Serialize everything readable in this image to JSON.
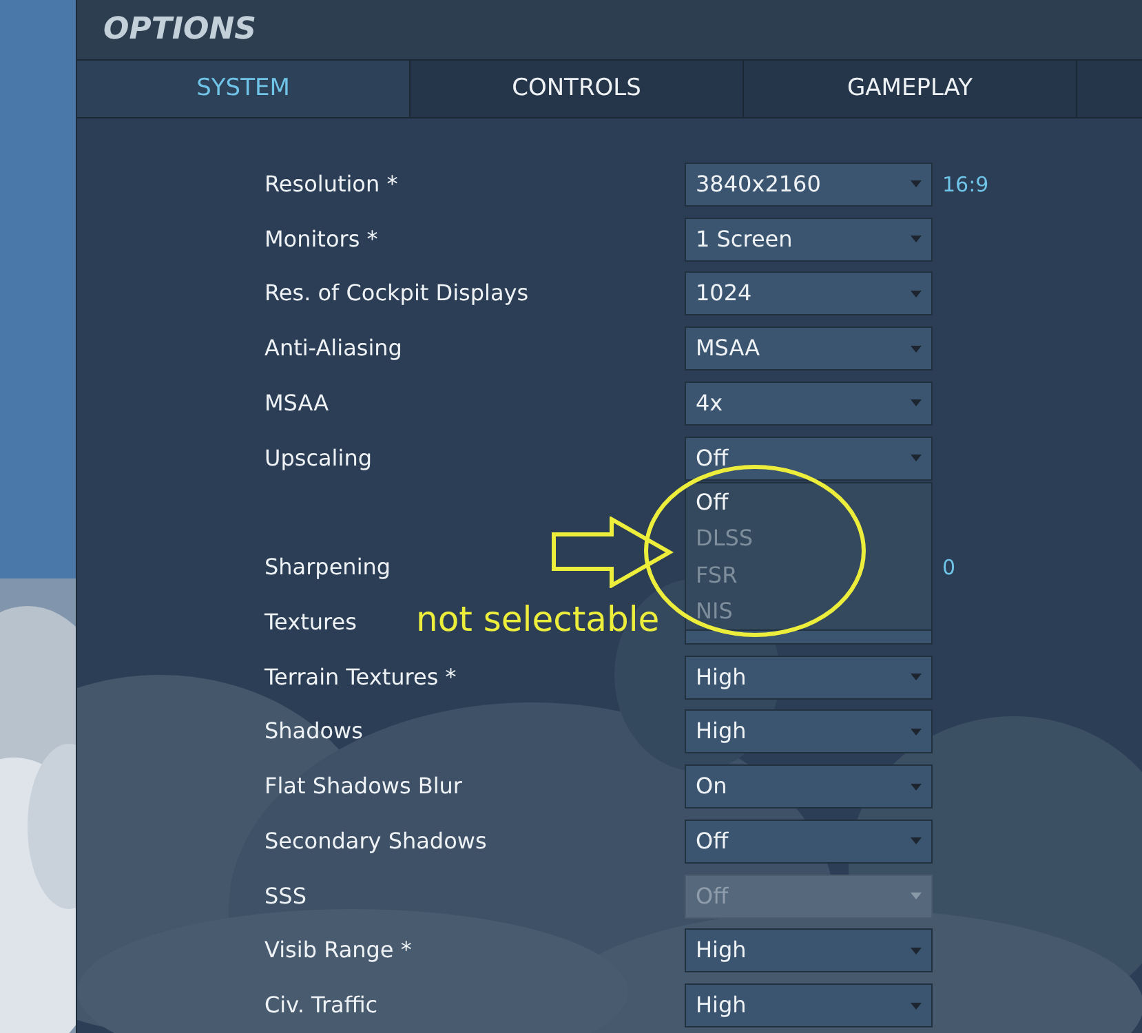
{
  "window": {
    "title": "OPTIONS"
  },
  "tabs": [
    {
      "label": "SYSTEM",
      "selected": true
    },
    {
      "label": "CONTROLS",
      "selected": false
    },
    {
      "label": "GAMEPLAY",
      "selected": false
    }
  ],
  "settings": [
    {
      "kind": "select",
      "label": "Resolution *",
      "value": "3840x2160",
      "disabled": false,
      "note": "16:9"
    },
    {
      "kind": "select",
      "label": "Monitors *",
      "value": "1 Screen",
      "disabled": false
    },
    {
      "kind": "select",
      "label": "Res. of Cockpit Displays",
      "value": "1024",
      "disabled": false
    },
    {
      "kind": "select",
      "label": "Anti-Aliasing",
      "value": "MSAA",
      "disabled": false
    },
    {
      "kind": "select",
      "label": "MSAA",
      "value": "4x",
      "disabled": false
    },
    {
      "kind": "select",
      "label": "Upscaling",
      "value": "Off",
      "disabled": false,
      "expanded": true,
      "options": [
        {
          "label": "Off",
          "disabled": false
        },
        {
          "label": "DLSS",
          "disabled": true
        },
        {
          "label": "FSR",
          "disabled": true
        },
        {
          "label": "NIS",
          "disabled": true
        }
      ]
    },
    {
      "kind": "reading",
      "label": "Sharpening",
      "reading": "0"
    },
    {
      "kind": "select",
      "label": "Textures",
      "disabled": false
    },
    {
      "kind": "select",
      "label": "Terrain Textures *",
      "value": "High",
      "disabled": false
    },
    {
      "kind": "select",
      "label": "Shadows",
      "value": "High",
      "disabled": false
    },
    {
      "kind": "select",
      "label": "Flat Shadows Blur",
      "value": "On",
      "disabled": false
    },
    {
      "kind": "select",
      "label": "Secondary Shadows",
      "value": "Off",
      "disabled": false
    },
    {
      "kind": "select",
      "label": "SSS",
      "value": "Off",
      "disabled": true
    },
    {
      "kind": "select",
      "label": "Visib Range *",
      "value": "High",
      "disabled": false
    },
    {
      "kind": "select",
      "label": "Civ. Traffic",
      "value": "High",
      "disabled": false
    }
  ],
  "annotation": {
    "text": "not selectable"
  }
}
